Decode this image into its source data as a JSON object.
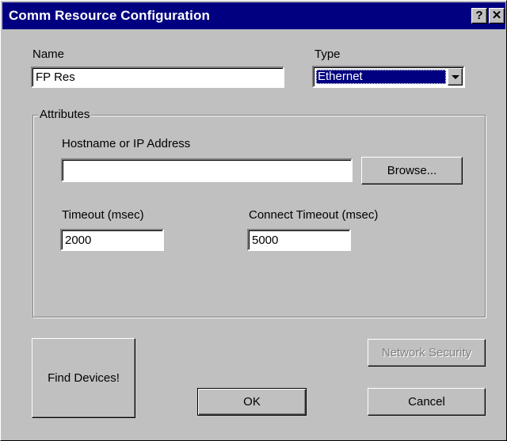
{
  "window": {
    "title": "Comm Resource Configuration",
    "help_glyph": "?",
    "close_glyph": "✕"
  },
  "name": {
    "label": "Name",
    "value": "FP Res"
  },
  "type": {
    "label": "Type",
    "selected": "Ethernet"
  },
  "attributes": {
    "legend": "Attributes",
    "hostname": {
      "label": "Hostname or IP Address",
      "value": ""
    },
    "browse_label": "Browse...",
    "timeout": {
      "label": "Timeout (msec)",
      "value": "2000"
    },
    "connect_timeout": {
      "label": "Connect Timeout (msec)",
      "value": "5000"
    }
  },
  "buttons": {
    "find_devices": "Find Devices!",
    "network_security": "Network Security",
    "ok": "OK",
    "cancel": "Cancel"
  },
  "colors": {
    "titlebar": "#000080",
    "face": "#c0c0c0",
    "selection": "#000080"
  }
}
